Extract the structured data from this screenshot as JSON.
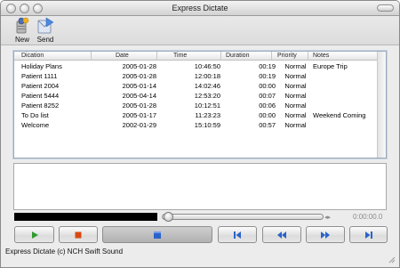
{
  "window": {
    "title": "Express Dictate"
  },
  "toolbar": {
    "new_label": "New",
    "send_label": "Send"
  },
  "table": {
    "headers": [
      "Dication",
      "Date",
      "Time",
      "Duration",
      "Priority",
      "Notes"
    ],
    "rows": [
      [
        "Holiday Plans",
        "2005-01-28",
        "10:46:50",
        "00:19",
        "Normal",
        "Europe Trip"
      ],
      [
        "Patient 1111",
        "2005-01-28",
        "12:00:18",
        "00:19",
        "Normal",
        ""
      ],
      [
        "Patient 2004",
        "2005-01-14",
        "14:02:46",
        "00:00",
        "Normal",
        ""
      ],
      [
        "Patient 5444",
        "2005-04-14",
        "12:53:20",
        "00:07",
        "Normal",
        ""
      ],
      [
        "Patient 8252",
        "2005-01-28",
        "10:12:51",
        "00:06",
        "Normal",
        ""
      ],
      [
        "To Do list",
        "2005-01-17",
        "11:23:23",
        "00:00",
        "Normal",
        "Weekend Coming"
      ],
      [
        "Welcome",
        "2002-01-29",
        "15:10:59",
        "00:57",
        "Normal",
        ""
      ]
    ]
  },
  "playback": {
    "time": "0:00:00.0",
    "position": 0
  },
  "transport": {
    "icons": [
      "play-icon",
      "stop-icon",
      "record-icon",
      "skip-to-start-icon",
      "rewind-icon",
      "fast-forward-icon",
      "skip-to-end-icon"
    ],
    "colors": {
      "play": "#2e9a2e",
      "stop": "#d9480f",
      "blue": "#2a63c9"
    }
  },
  "status": {
    "text": "Express Dictate (c) NCH Swift Sound"
  }
}
